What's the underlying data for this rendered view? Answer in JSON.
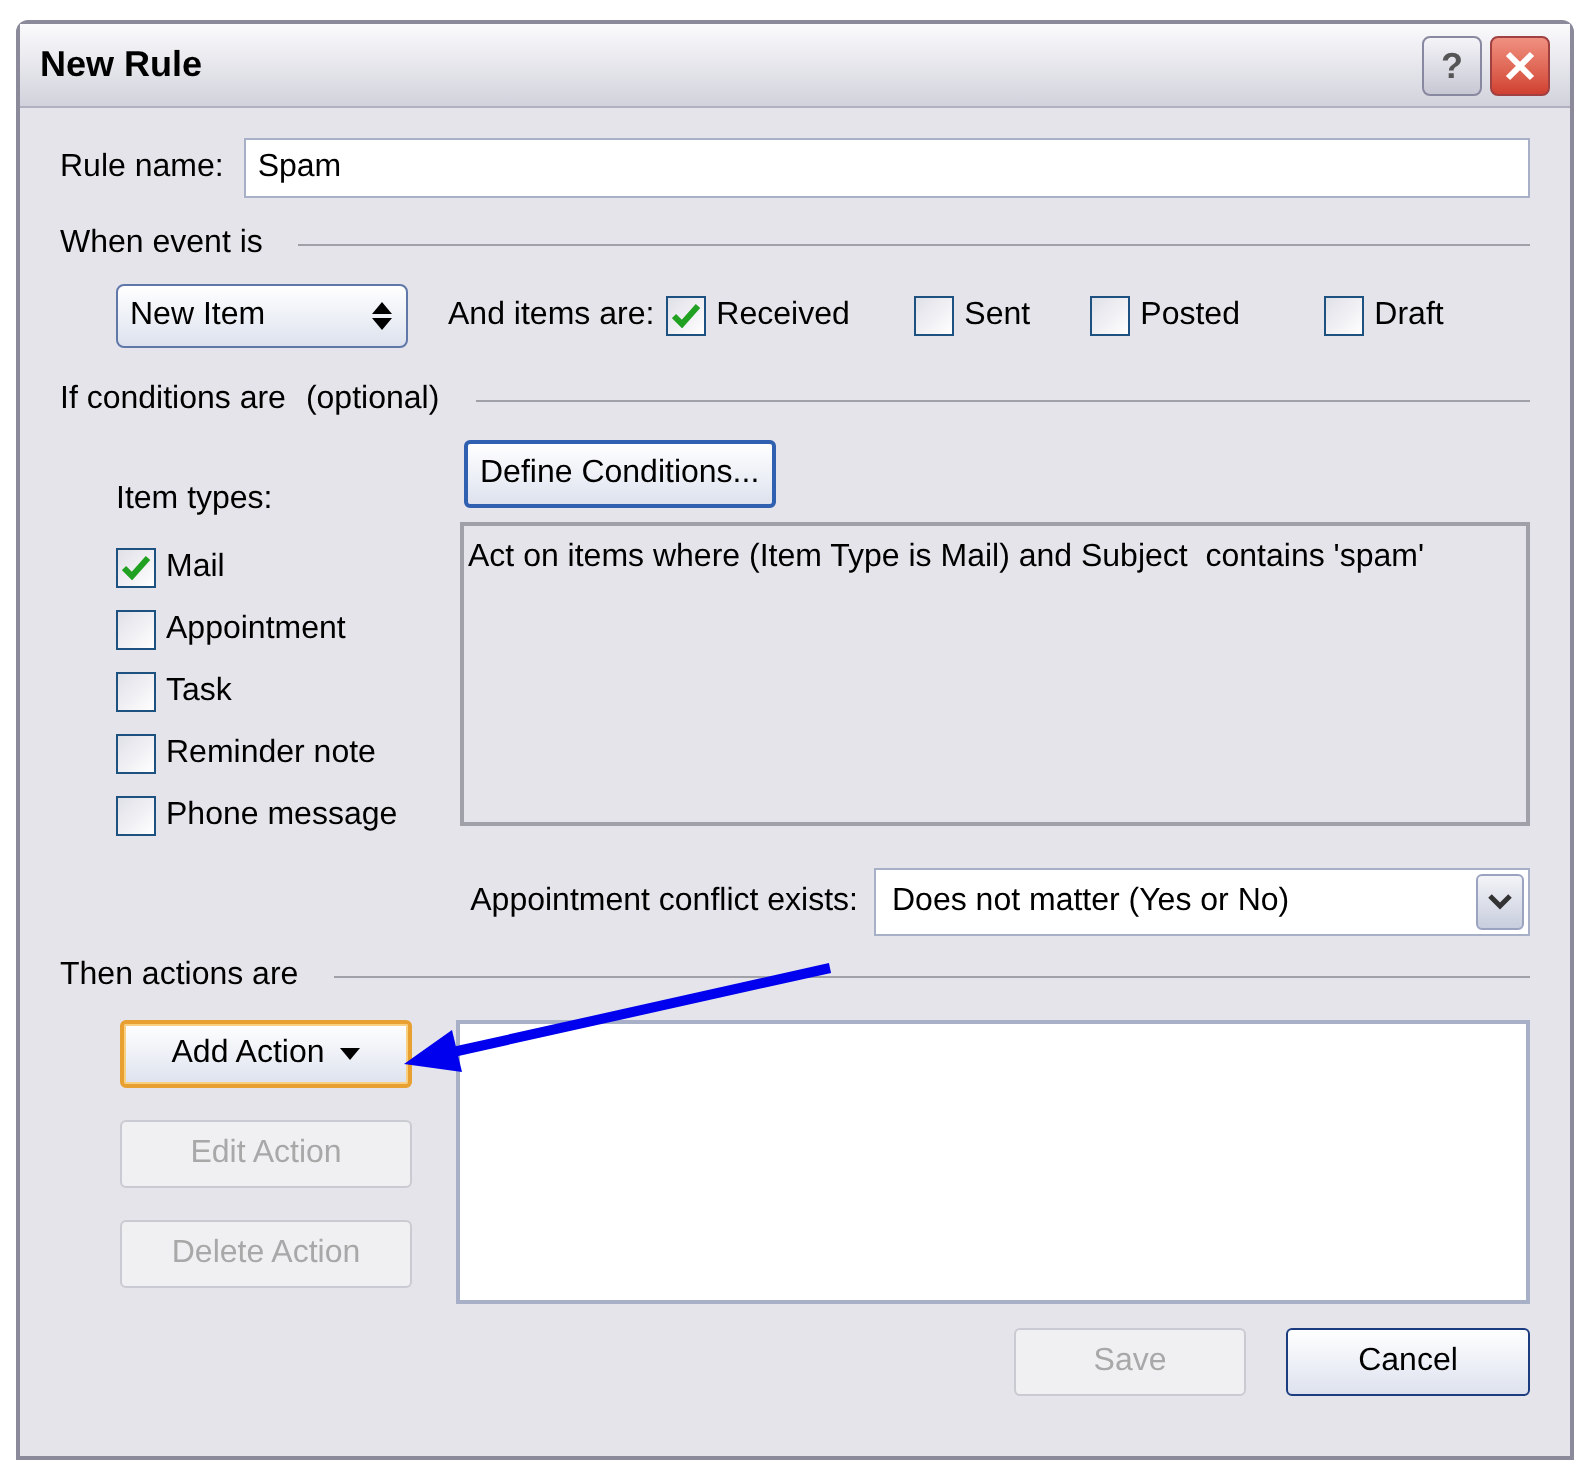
{
  "window": {
    "title": "New Rule",
    "help": "?"
  },
  "rule_name": {
    "label": "Rule name:",
    "value": "Spam"
  },
  "event": {
    "heading": "When event is",
    "dropdown": "New Item",
    "items_label": "And items are:",
    "items": [
      {
        "label": "Received",
        "checked": true
      },
      {
        "label": "Sent",
        "checked": false
      },
      {
        "label": "Posted",
        "checked": false
      },
      {
        "label": "Draft",
        "checked": false
      }
    ]
  },
  "conditions": {
    "heading": "If conditions are",
    "note": "(optional)",
    "types_label": "Item types:",
    "types": [
      {
        "label": "Mail",
        "checked": true
      },
      {
        "label": "Appointment",
        "checked": false
      },
      {
        "label": "Task",
        "checked": false
      },
      {
        "label": "Reminder note",
        "checked": false
      },
      {
        "label": "Phone message",
        "checked": false
      }
    ],
    "define_button": "Define Conditions...",
    "description": "Act on items where (Item Type is Mail) and Subject  contains 'spam'",
    "conflict_label": "Appointment conflict exists:",
    "conflict_value": "Does not matter (Yes or No)"
  },
  "actions": {
    "heading": "Then actions are",
    "buttons": [
      {
        "label": "Add Action",
        "kind": "dropdown",
        "disabled": false,
        "highlighted": true
      },
      {
        "label": "Edit Action",
        "kind": "plain",
        "disabled": true,
        "highlighted": false
      },
      {
        "label": "Delete Action",
        "kind": "plain",
        "disabled": true,
        "highlighted": false
      }
    ]
  },
  "footer_buttons": [
    {
      "label": "Save",
      "disabled": true
    },
    {
      "label": "Cancel",
      "disabled": false
    }
  ]
}
